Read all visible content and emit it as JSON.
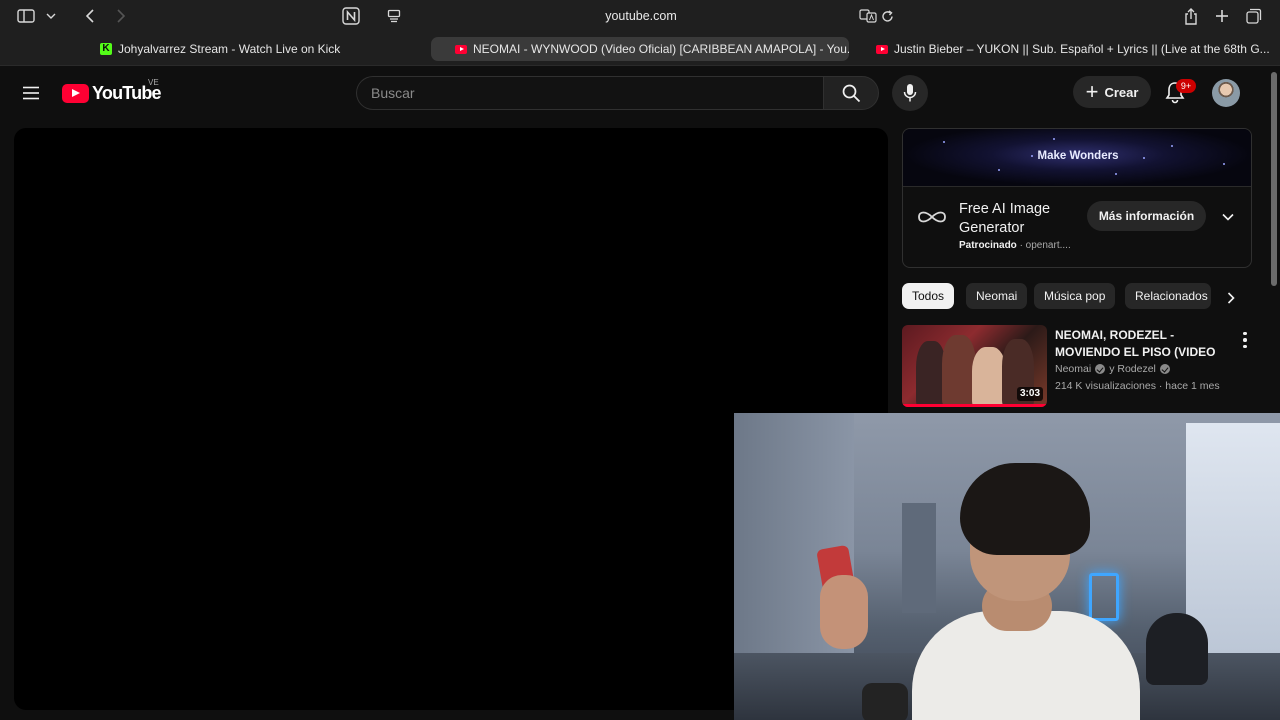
{
  "browser": {
    "url": "youtube.com",
    "tabs": [
      {
        "title": "Johyalvarrez Stream - Watch Live on Kick",
        "active": false,
        "favicon": "kick"
      },
      {
        "title": "NEOMAI - WYNWOOD (Video Oficial) [CARIBBEAN AMAPOLA] - You...",
        "active": true,
        "favicon": "youtube"
      },
      {
        "title": "Justin Bieber – YUKON || Sub. Español + Lyrics || (Live at the 68th G...",
        "active": false,
        "favicon": "youtube"
      }
    ],
    "icons": [
      "sidebar-icon",
      "chevron-down-icon",
      "back-icon",
      "forward-icon",
      "notion-icon",
      "reader-icon",
      "translate-icon",
      "reload-icon",
      "share-icon",
      "new-tab-icon",
      "tab-overview-icon"
    ]
  },
  "header": {
    "logo_text": "YouTube",
    "region": "VE",
    "search_placeholder": "Buscar",
    "create_label": "Crear",
    "notifications_badge": "9+"
  },
  "ad": {
    "banner_text": "Make Wonders",
    "title": "Free AI Image Generator",
    "sponsored_label": "Patrocinado",
    "advertiser": "· openart....",
    "cta_label": "Más información"
  },
  "chips": [
    {
      "label": "Todos",
      "selected": true
    },
    {
      "label": "Neomai",
      "selected": false
    },
    {
      "label": "Música pop",
      "selected": false
    },
    {
      "label": "Relacionados",
      "selected": false
    }
  ],
  "related": [
    {
      "title": "NEOMAI, RODEZEL - MOVIENDO EL PISO (VIDEO ...",
      "channel_1": "Neomai",
      "channel_joiner": "y Rodezel",
      "stats": "214 K visualizaciones · hace 1 mes",
      "duration": "3:03"
    }
  ],
  "colors": {
    "background": "#0f0f0f",
    "brand_red": "#ff0033",
    "chip_bg": "#272727",
    "text": "#f1f1f1",
    "muted_text": "#aaaaaa"
  }
}
